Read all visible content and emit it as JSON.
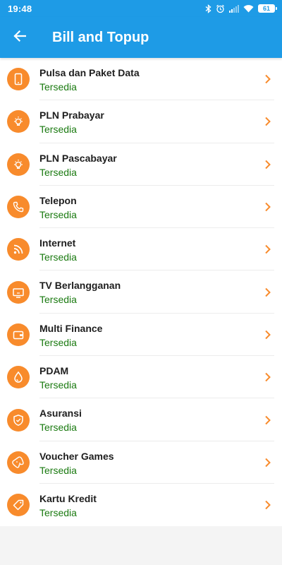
{
  "status_bar": {
    "time": "19:48",
    "battery": "61",
    "icons": [
      "bluetooth-icon",
      "alarm-icon",
      "signal-icon",
      "wifi-icon",
      "battery-icon"
    ]
  },
  "app_bar": {
    "title": "Bill and Topup",
    "back_icon": "arrow-left-icon"
  },
  "colors": {
    "primary": "#1e9be6",
    "icon_bg": "#f88b2c",
    "status_text": "#1a7a10",
    "chevron": "#f88b2c"
  },
  "items": [
    {
      "title": "Pulsa dan Paket Data",
      "status": "Tersedia",
      "icon": "phone-icon"
    },
    {
      "title": "PLN Prabayar",
      "status": "Tersedia",
      "icon": "bulb-icon"
    },
    {
      "title": "PLN Pascabayar",
      "status": "Tersedia",
      "icon": "bulb-icon"
    },
    {
      "title": "Telepon",
      "status": "Tersedia",
      "icon": "telephone-icon"
    },
    {
      "title": "Internet",
      "status": "Tersedia",
      "icon": "rss-icon"
    },
    {
      "title": "TV Berlangganan",
      "status": "Tersedia",
      "icon": "tv-icon"
    },
    {
      "title": "Multi Finance",
      "status": "Tersedia",
      "icon": "wallet-icon"
    },
    {
      "title": "PDAM",
      "status": "Tersedia",
      "icon": "water-drop-icon"
    },
    {
      "title": "Asuransi",
      "status": "Tersedia",
      "icon": "shield-icon"
    },
    {
      "title": "Voucher Games",
      "status": "Tersedia",
      "icon": "gamepad-icon"
    },
    {
      "title": "Kartu Kredit",
      "status": "Tersedia",
      "icon": "tag-icon"
    }
  ]
}
